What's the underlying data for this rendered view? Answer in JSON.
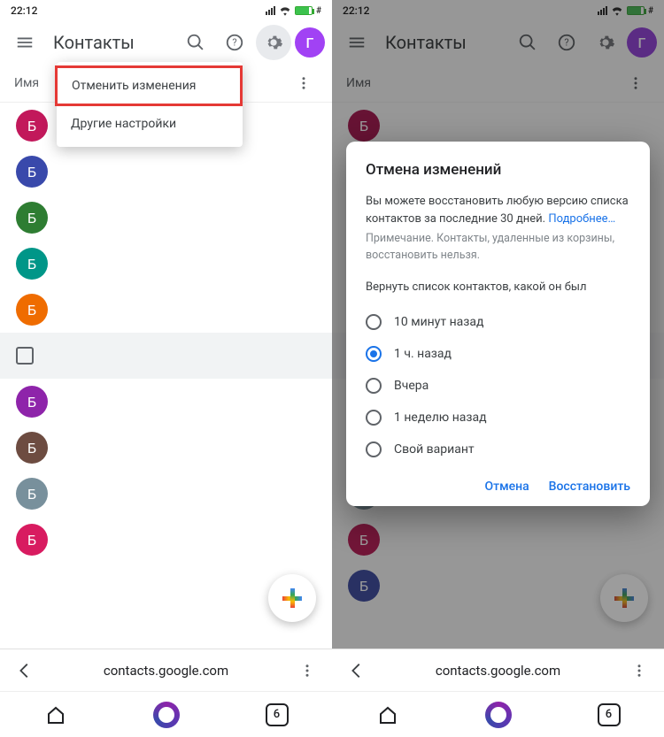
{
  "status": {
    "time": "22:12"
  },
  "header": {
    "title": "Контакты",
    "avatar_letter": "Г"
  },
  "section": {
    "label": "Имя"
  },
  "dropdown": {
    "item_undo": "Отменить изменения",
    "item_other": "Другие настройки"
  },
  "contacts": {
    "letter": "Б",
    "colors": [
      "#c2185b",
      "#3949ab",
      "#2e7d32",
      "#009688",
      "#ef6c00",
      "#8e24aa",
      "#6d4c41",
      "#78909c",
      "#d81b60",
      "#3f51b5"
    ]
  },
  "urlbar": {
    "url": "contacts.google.com"
  },
  "botnav": {
    "tab_count": "6"
  },
  "dialog": {
    "title": "Отмена изменений",
    "desc_a": "Вы можете восстановить любую версию списка контактов за последние 30 дней. ",
    "desc_link": "Подробнее…",
    "note": "Примечание. Контакты, удаленные из корзины, восстановить нельзя.",
    "prompt": "Вернуть список контактов, какой он был",
    "options": [
      "10 минут назад",
      "1 ч. назад",
      "Вчера",
      "1 неделю назад",
      "Свой вариант"
    ],
    "selected_index": 1,
    "cancel": "Отмена",
    "restore": "Восстановить"
  }
}
